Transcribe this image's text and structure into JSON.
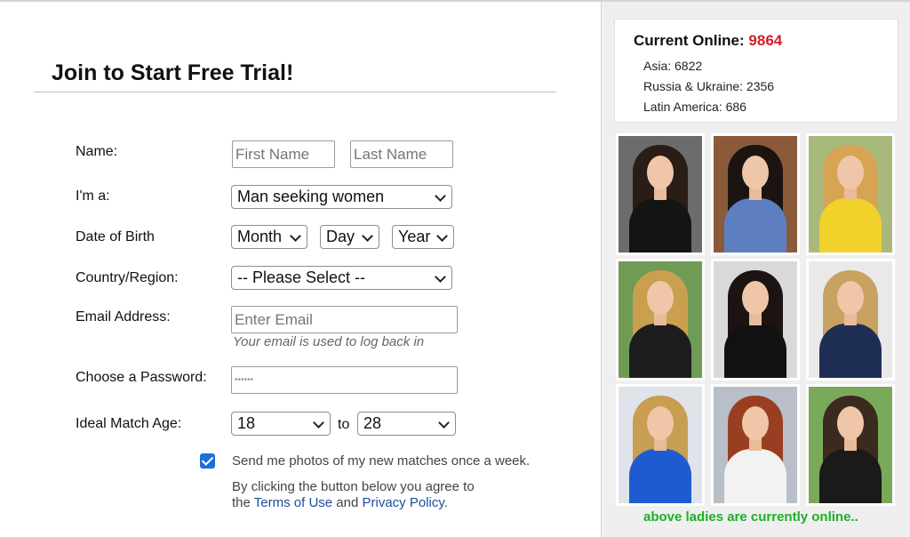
{
  "form": {
    "title": "Join to Start Free Trial!",
    "labels": {
      "name": "Name:",
      "im_a": "I'm a:",
      "dob": "Date of Birth",
      "country": "Country/Region:",
      "email": "Email Address:",
      "password": "Choose a Password:",
      "match_age": "Ideal Match Age:",
      "to": "to"
    },
    "first_name_placeholder": "First Name",
    "last_name_placeholder": "Last Name",
    "seeking_value": "Man seeking women",
    "month_value": "Month",
    "day_value": "Day",
    "year_value": "Year",
    "country_value": "-- Please Select --",
    "email_placeholder": "Enter Email",
    "email_hint": "Your email is used to log back in",
    "password_value": "••••••",
    "age_from": "18",
    "age_to": "28",
    "newsletter_text": "Send me photos of my new matches once a week.",
    "agree_text_1": "By clicking the button below you agree to",
    "agree_text_2_prefix": "the",
    "terms_link": "Terms of Use",
    "agree_and": "and",
    "privacy_link": "Privacy Policy",
    "agree_end": ".",
    "newsletter_checked": true
  },
  "stats": {
    "label": "Current Online:",
    "count": "9864",
    "regions": [
      {
        "text": "Asia: 6822"
      },
      {
        "text": "Russia & Ukraine: 2356"
      },
      {
        "text": "Latin America: 686"
      }
    ]
  },
  "photos": [
    {
      "bg": "#6c6c6c",
      "hair": "#2a1c16",
      "top": "#141414"
    },
    {
      "bg": "#8a5a3a",
      "hair": "#1b1410",
      "top": "#5d7fc2"
    },
    {
      "bg": "#a9b97c",
      "hair": "#d6a453",
      "top": "#f1d22b"
    },
    {
      "bg": "#6f9b55",
      "hair": "#caa04e",
      "top": "#1d1d1d"
    },
    {
      "bg": "#d9d9d9",
      "hair": "#1c1412",
      "top": "#111111"
    },
    {
      "bg": "#e9e9e9",
      "hair": "#c8a260",
      "top": "#1f2e55"
    },
    {
      "bg": "#dfe3ea",
      "hair": "#c89e52",
      "top": "#1e5bd0"
    },
    {
      "bg": "#b8bfc8",
      "hair": "#9a3e22",
      "top": "#f2f2f2"
    },
    {
      "bg": "#7aa95a",
      "hair": "#3a2a20",
      "top": "#1a1a1a"
    }
  ],
  "online_caption": "above ladies are currently online.."
}
